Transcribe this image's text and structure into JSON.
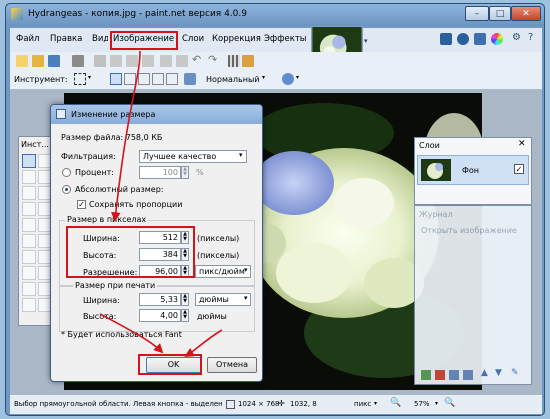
{
  "window": {
    "title": "Hydrangeas - копия.jpg - paint.net версия 4.0.9",
    "controls": [
      "–",
      "□",
      "✕"
    ]
  },
  "menu": [
    "Файл",
    "Правка",
    "Вид",
    "Изображение",
    "Слои",
    "Коррекция",
    "Эффекты"
  ],
  "toolbar": {
    "instrument_label": "Инструмент:",
    "blend_mode": "Нормальный"
  },
  "tools_panel": {
    "title": "Инст..."
  },
  "dialog": {
    "title": "Изменение размера",
    "file_size": "Размер файла: 758,0 КБ",
    "filter_label": "Фильтрация:",
    "filter_value": "Лучшее качество",
    "percent_label": "Процент:",
    "percent_value": "100",
    "percent_unit": "%",
    "absolute_label": "Абсолютный размер:",
    "keep_ratio_label": "Сохранять пропорции",
    "pixel_group_label": "Размер в пикселах",
    "width_label": "Ширина:",
    "width_value": "512",
    "width_unit": "(пикселы)",
    "height_label": "Высота:",
    "height_value": "384",
    "height_unit": "(пикселы)",
    "resolution_label": "Разрешение:",
    "resolution_value": "96,00",
    "resolution_unit": "пикс/дюйм",
    "print_group_label": "Размер при печати",
    "print_width_label": "Ширина:",
    "print_width_value": "5,33",
    "print_width_unit": "дюймы",
    "print_height_label": "Высота:",
    "print_height_value": "4,00",
    "print_height_unit": "дюймы",
    "footnote": "* Будет использоваться Fant",
    "ok_label": "OK",
    "cancel_label": "Отмена"
  },
  "layers_panel": {
    "title": "Слои",
    "layer_name": "Фон"
  },
  "history_panel": {
    "title": "Журнал",
    "item": "Открыть изображение"
  },
  "statusbar": {
    "hint": "Выбор прямоугольной области. Левая кнопка - выделение области. Зажм...",
    "image_size": "1024 × 768",
    "cursor_pos": "1032, 8",
    "units": "пикс",
    "zoom": "57%"
  },
  "colors": {
    "highlight": "#d4141c",
    "title_bar": "#8eb5dc",
    "menu_bg": "#dfe8f3"
  }
}
